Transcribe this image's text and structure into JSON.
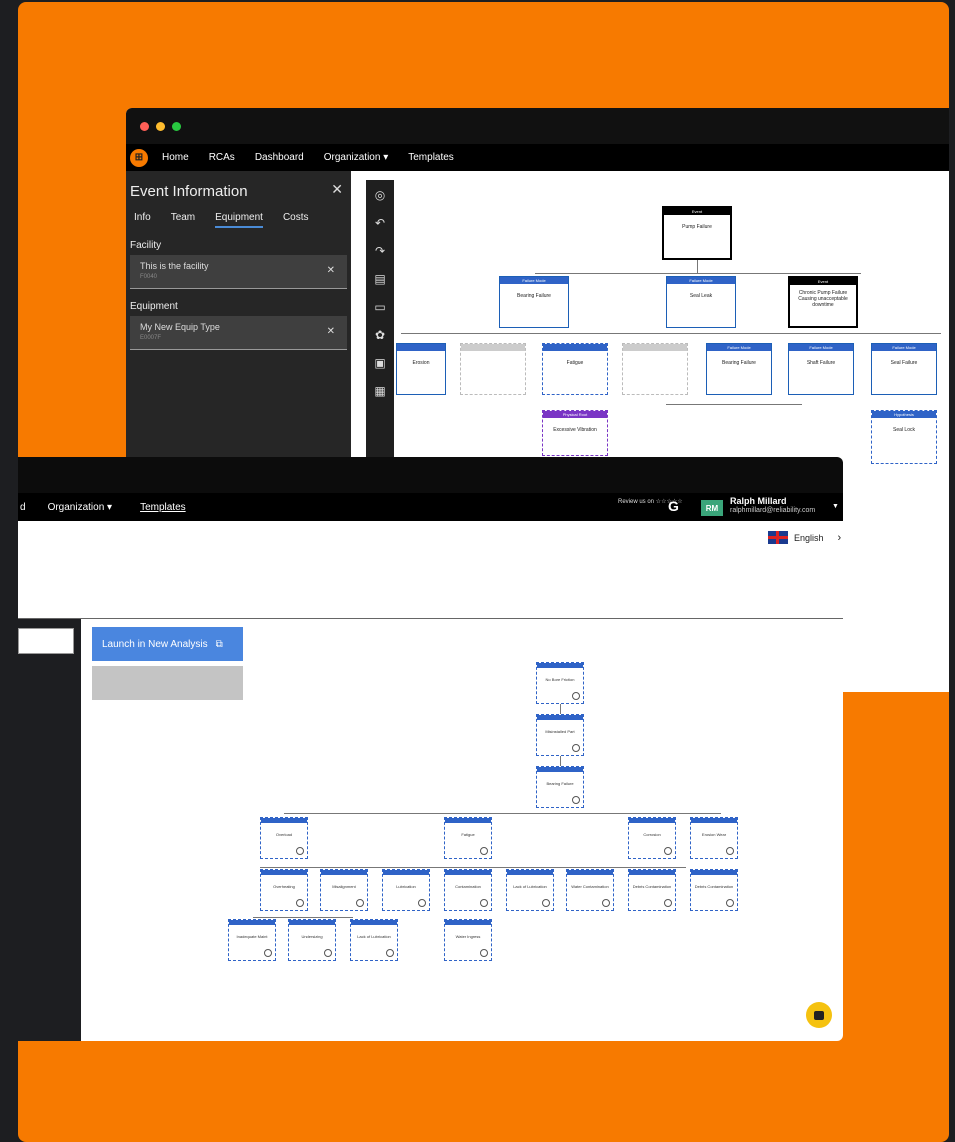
{
  "back_window": {
    "nav": {
      "items": [
        "Home",
        "RCAs",
        "Dashboard",
        "Organization ▾",
        "Templates"
      ]
    },
    "event_panel": {
      "title": "Event Information",
      "tabs": [
        "Info",
        "Team",
        "Equipment",
        "Costs"
      ],
      "active_tab": "Equipment",
      "facility_label": "Facility",
      "facility_value": "This is the facility",
      "facility_sub": "F0040",
      "equipment_label": "Equipment",
      "equipment_value": "My New Equip Type",
      "equipment_sub": "E0007F"
    },
    "diagram": {
      "event_label": "Event",
      "event_text": "Pump Failure",
      "failure_mode_label": "Failure Mode",
      "mode1": "Bearing Failure",
      "mode2": "Seal Leak",
      "event2_text": "Chronic Pump Failure Causing unacceptable downtime",
      "sub_nodes": [
        "Erosion",
        "Fatigue",
        "Bearing Failure",
        "Shaft Failure",
        "Seal Failure"
      ],
      "physical_root_label": "Physical Root",
      "physical_root_text": "Excessive Vibration",
      "hypothesis_label": "Hypothesis",
      "hypothesis_text": "Seal Lock"
    }
  },
  "front_window": {
    "nav": {
      "partial": "d",
      "organization": "Organization ▾",
      "templates": "Templates"
    },
    "review": "Review us on ☆☆☆☆☆",
    "g2": "G",
    "user": {
      "initials": "RM",
      "name": "Ralph Millard",
      "email": "ralphmillard@reliability.com"
    },
    "language": "English",
    "launch_button": "Launch in New Analysis",
    "tree_nodes": [
      "No Bore Friction",
      "Misinstalled Part",
      "Bearing Failure",
      "Overload",
      "Fatigue",
      "Corrosion",
      "Erosion Wear",
      "Overheating",
      "Misalignment",
      "Lubrication",
      "Contamination",
      "Lack of Lubrication",
      "Water Contamination",
      "Debris Contamination",
      "Inadequate Maint",
      "Undersizing",
      "Lack of Lubrication",
      "Water Ingress"
    ]
  }
}
